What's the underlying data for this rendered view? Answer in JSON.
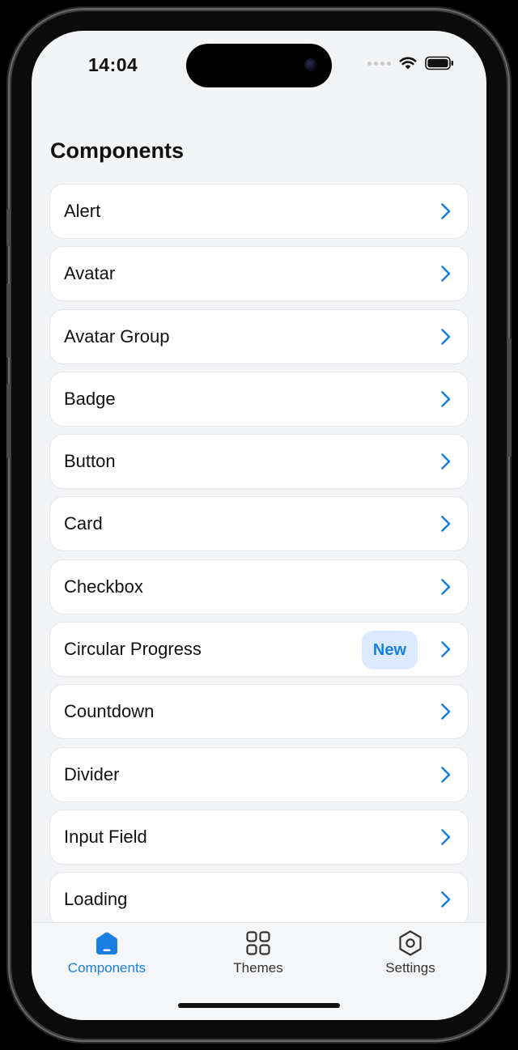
{
  "status_bar": {
    "time": "14:04"
  },
  "header": {
    "title": "Components"
  },
  "components": [
    {
      "label": "Alert"
    },
    {
      "label": "Avatar"
    },
    {
      "label": "Avatar Group"
    },
    {
      "label": "Badge"
    },
    {
      "label": "Button"
    },
    {
      "label": "Card"
    },
    {
      "label": "Checkbox"
    },
    {
      "label": "Circular Progress",
      "badge": "New"
    },
    {
      "label": "Countdown"
    },
    {
      "label": "Divider"
    },
    {
      "label": "Input Field"
    },
    {
      "label": "Loading"
    }
  ],
  "tab_bar": {
    "tabs": [
      {
        "label": "Components",
        "icon": "home-icon",
        "active": true
      },
      {
        "label": "Themes",
        "icon": "grid-icon",
        "active": false
      },
      {
        "label": "Settings",
        "icon": "gear-hexagon-icon",
        "active": false
      }
    ]
  },
  "colors": {
    "accent": "#1a7fe0",
    "background": "#f3f4f6",
    "card": "#ffffff",
    "badge_bg": "#dbeafe"
  }
}
